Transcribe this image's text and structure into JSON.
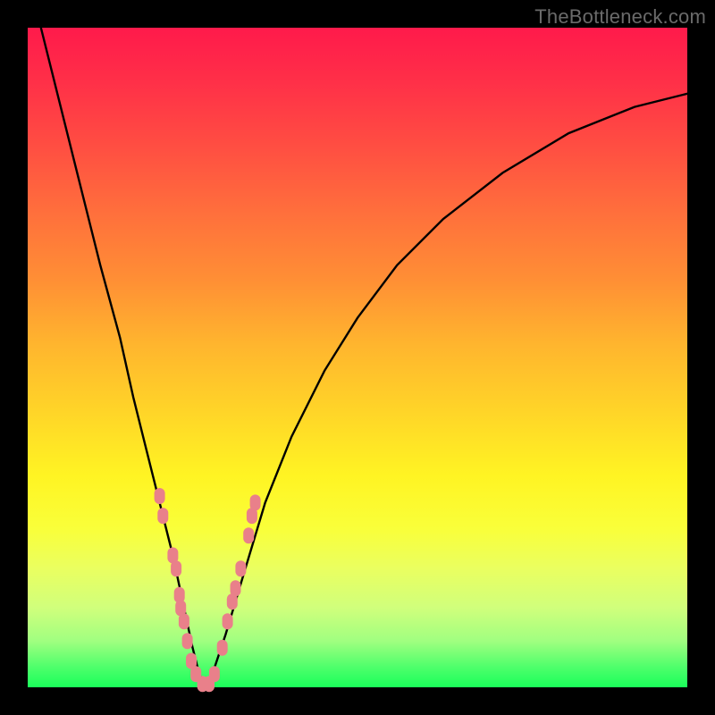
{
  "watermark": "TheBottleneck.com",
  "colors": {
    "frame": "#000000",
    "watermark": "#6a6a6a",
    "curve": "#000000",
    "dots": "#e9808a",
    "gradient_stops": [
      "#ff1a4b",
      "#ff2f48",
      "#ff4e42",
      "#ff6f3c",
      "#ff8e35",
      "#ffb52e",
      "#ffd428",
      "#fff423",
      "#f9ff3a",
      "#eaff60",
      "#d0ff7c",
      "#a0ff80",
      "#4dff6b",
      "#1aff5a"
    ]
  },
  "chart_data": {
    "type": "line",
    "title": "",
    "xlabel": "",
    "ylabel": "",
    "xlim": [
      0,
      100
    ],
    "ylim": [
      0,
      100
    ],
    "grid": false,
    "legend": false,
    "series": [
      {
        "name": "bottleneck-curve",
        "x": [
          2,
          5,
          8,
          11,
          14,
          16,
          18,
          20,
          22,
          23.5,
          25,
          26,
          27,
          28,
          30,
          33,
          36,
          40,
          45,
          50,
          56,
          63,
          72,
          82,
          92,
          100
        ],
        "y": [
          100,
          88,
          76,
          64,
          53,
          44,
          36,
          28,
          20,
          13,
          6,
          2,
          0,
          2,
          8,
          18,
          28,
          38,
          48,
          56,
          64,
          71,
          78,
          84,
          88,
          90
        ]
      }
    ],
    "scatter_points": {
      "name": "markers",
      "points": [
        {
          "x": 20.0,
          "y": 29
        },
        {
          "x": 20.5,
          "y": 26
        },
        {
          "x": 22.0,
          "y": 20
        },
        {
          "x": 22.5,
          "y": 18
        },
        {
          "x": 23.0,
          "y": 14
        },
        {
          "x": 23.2,
          "y": 12
        },
        {
          "x": 23.7,
          "y": 10
        },
        {
          "x": 24.2,
          "y": 7
        },
        {
          "x": 24.8,
          "y": 4
        },
        {
          "x": 25.5,
          "y": 2
        },
        {
          "x": 26.5,
          "y": 0.5
        },
        {
          "x": 27.5,
          "y": 0.5
        },
        {
          "x": 28.3,
          "y": 2
        },
        {
          "x": 29.5,
          "y": 6
        },
        {
          "x": 30.3,
          "y": 10
        },
        {
          "x": 31.0,
          "y": 13
        },
        {
          "x": 31.5,
          "y": 15
        },
        {
          "x": 32.3,
          "y": 18
        },
        {
          "x": 33.5,
          "y": 23
        },
        {
          "x": 34.0,
          "y": 26
        },
        {
          "x": 34.5,
          "y": 28
        }
      ]
    }
  }
}
